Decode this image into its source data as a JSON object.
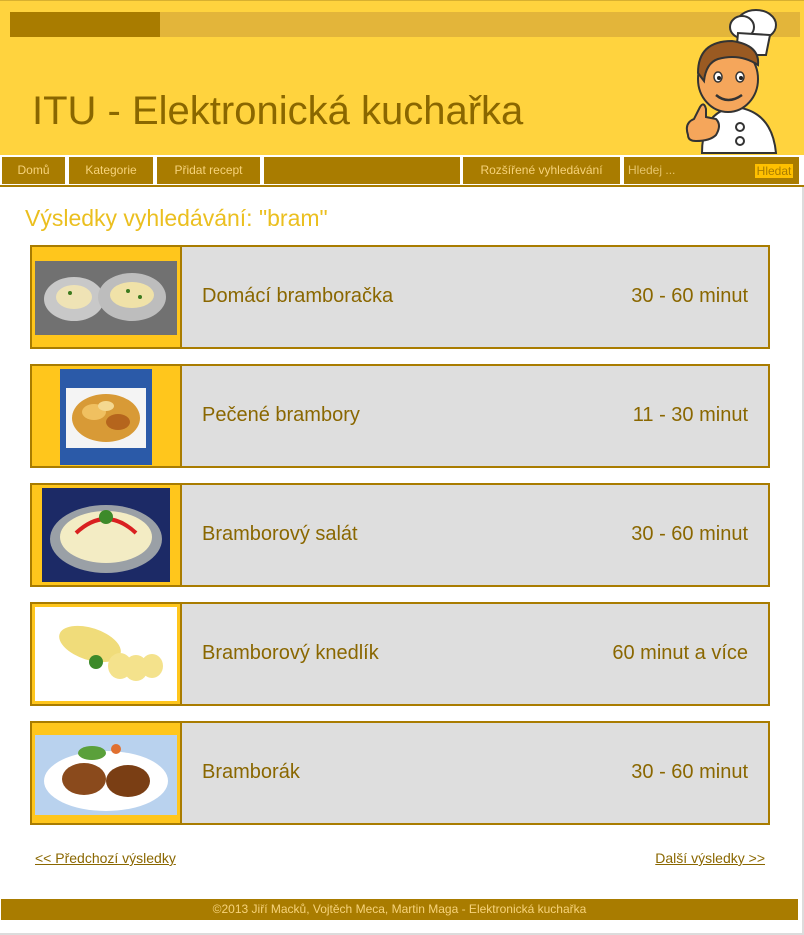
{
  "header": {
    "title": "ITU - Elektronická kuchařka"
  },
  "nav": {
    "items": [
      {
        "label": "Domů"
      },
      {
        "label": "Kategorie"
      },
      {
        "label": "Přidat recept"
      },
      {
        "label": ""
      },
      {
        "label": "Rozšířené vyhledávání"
      }
    ],
    "search_placeholder": "Hledej ...",
    "search_button": "Hledat"
  },
  "results": {
    "heading": "Výsledky vyhledávání: \"bram\"",
    "items": [
      {
        "title": "Domácí bramboračka",
        "time": "30 - 60 minut"
      },
      {
        "title": "Pečené brambory",
        "time": "11 - 30 minut"
      },
      {
        "title": "Bramborový salát",
        "time": "30 - 60 minut"
      },
      {
        "title": "Bramborový knedlík",
        "time": "60 minut a více"
      },
      {
        "title": "Bramborák",
        "time": "30 - 60 minut"
      }
    ]
  },
  "pagination": {
    "prev": "<< Předchozí výsledky",
    "next": "Další výsledky >>"
  },
  "footer": {
    "text": "©2013 Jiří Macků, Vojtěch Meca, Martin Maga - Elektronická kuchařka"
  },
  "colors": {
    "header_bg": "#ffd33e",
    "accent_dark": "#a97c00",
    "accent_text": "#8a6700",
    "card_bg": "#dedede",
    "thumb_bg": "#ffc61c"
  }
}
